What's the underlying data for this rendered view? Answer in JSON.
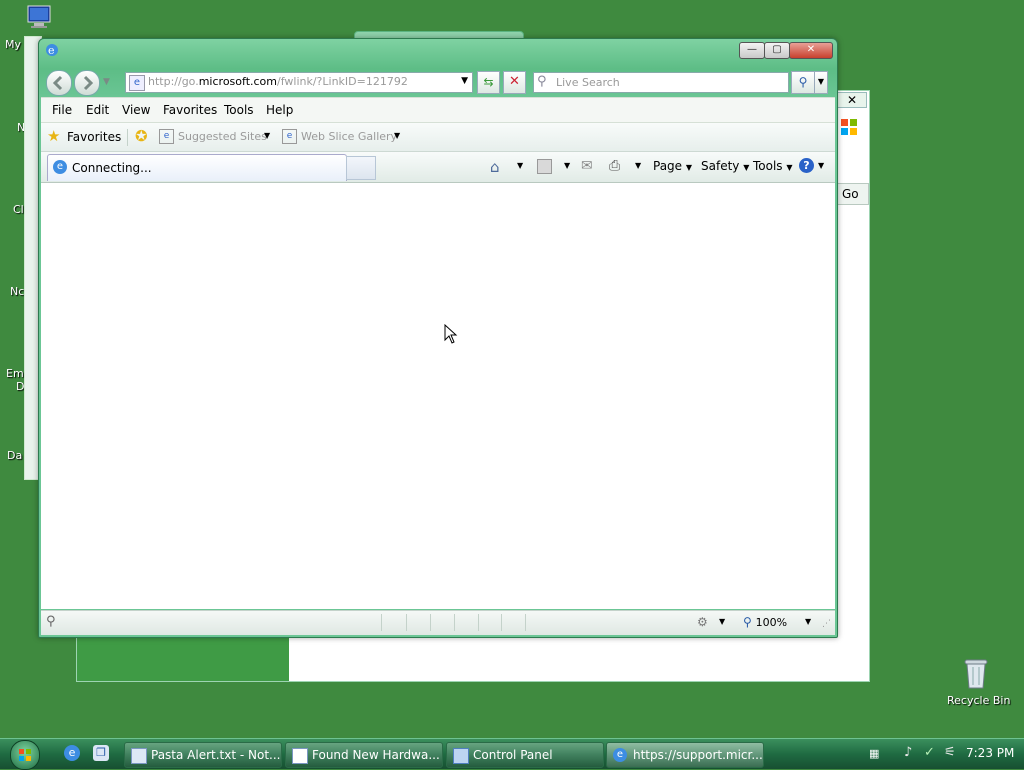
{
  "desktop": {
    "left_labels": [
      "My",
      "N",
      "Cl",
      "Nc",
      "Em",
      "D",
      "Da"
    ],
    "recycle_bin": "Recycle Bin"
  },
  "background_window": {
    "go_label": "Go"
  },
  "ie": {
    "address": {
      "prefix": "http://go.",
      "domain": "microsoft.com",
      "path": "/fwlink/?LinkID=121792"
    },
    "search_placeholder": "Live Search",
    "menu": [
      "File",
      "Edit",
      "View",
      "Favorites",
      "Tools",
      "Help"
    ],
    "favorites_bar": {
      "favorites": "Favorites",
      "suggested_sites": "Suggested Sites",
      "web_slice_gallery": "Web Slice Gallery"
    },
    "tab": {
      "label": "Connecting..."
    },
    "command_bar": {
      "page": "Page",
      "safety": "Safety",
      "tools": "Tools"
    },
    "status": {
      "zoom": "100%"
    }
  },
  "taskbar": {
    "items": [
      {
        "label": "Pasta Alert.txt - Not...",
        "active": false
      },
      {
        "label": "Found New Hardwa...",
        "active": false
      },
      {
        "label": "Control Panel",
        "active": false
      },
      {
        "label": "https://support.micr...",
        "active": true
      }
    ],
    "clock": "7:23 PM"
  },
  "colors": {
    "desktop": "#3f8a3f",
    "ie_frame": "#6bc695",
    "taskbar": "#1f6b42"
  }
}
